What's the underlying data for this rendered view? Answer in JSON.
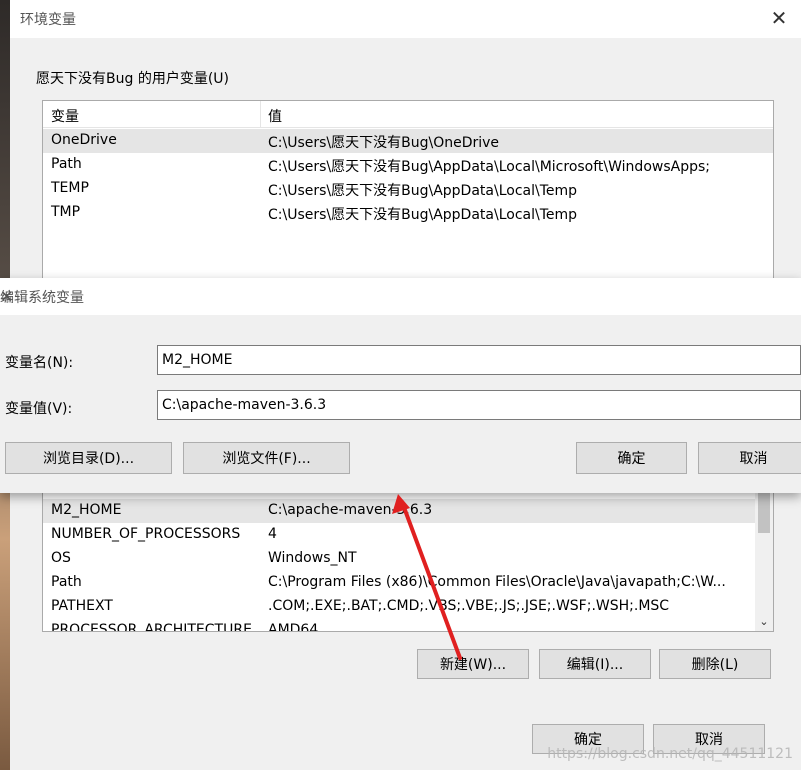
{
  "env_window": {
    "title": "环境变量",
    "user_group_label": "愿天下没有Bug 的用户变量(U)",
    "columns": [
      "变量",
      "值"
    ],
    "user_vars": [
      {
        "name": "OneDrive",
        "value": "C:\\Users\\愿天下没有Bug\\OneDrive"
      },
      {
        "name": "Path",
        "value": "C:\\Users\\愿天下没有Bug\\AppData\\Local\\Microsoft\\WindowsApps;"
      },
      {
        "name": "TEMP",
        "value": "C:\\Users\\愿天下没有Bug\\AppData\\Local\\Temp"
      },
      {
        "name": "TMP",
        "value": "C:\\Users\\愿天下没有Bug\\AppData\\Local\\Temp"
      }
    ],
    "sys_vars": [
      {
        "name": "M2_HOME",
        "value": "C:\\apache-maven-3.6.3"
      },
      {
        "name": "NUMBER_OF_PROCESSORS",
        "value": "4"
      },
      {
        "name": "OS",
        "value": "Windows_NT"
      },
      {
        "name": "Path",
        "value": "C:\\Program Files (x86)\\Common Files\\Oracle\\Java\\javapath;C:\\W..."
      },
      {
        "name": "PATHEXT",
        "value": ".COM;.EXE;.BAT;.CMD;.VBS;.VBE;.JS;.JSE;.WSF;.WSH;.MSC"
      },
      {
        "name": "PROCESSOR_ARCHITECTURE",
        "value": "AMD64"
      }
    ],
    "buttons": {
      "new": "新建(W)...",
      "edit": "编辑(I)...",
      "delete": "删除(L)",
      "ok": "确定",
      "cancel": "取消"
    }
  },
  "edit_dialog": {
    "title": "编辑系统变量",
    "name_label": "变量名(N):",
    "name_value": "M2_HOME",
    "value_label": "变量值(V):",
    "value_value": "C:\\apache-maven-3.6.3",
    "buttons": {
      "browse_dir": "浏览目录(D)...",
      "browse_file": "浏览文件(F)...",
      "ok": "确定",
      "cancel": "取消"
    }
  },
  "watermark": "https://blog.csdn.net/qq_44511121",
  "colors": {
    "annotation_arrow": "#e02020",
    "selected_row": "#e5e5e5"
  }
}
